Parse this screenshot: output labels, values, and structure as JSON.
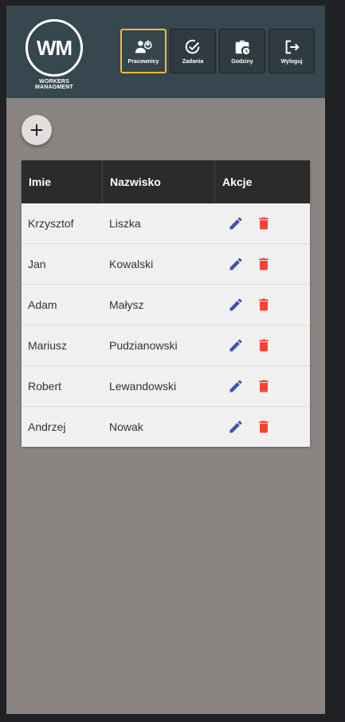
{
  "app": {
    "logo_initials": "WM",
    "logo_caption": "WORKERS MANAGMENT"
  },
  "nav": {
    "items": [
      {
        "label": "Pracownicy",
        "icon": "workers-settings-icon",
        "active": true
      },
      {
        "label": "Zadania",
        "icon": "check-circle-icon",
        "active": false
      },
      {
        "label": "Godziny",
        "icon": "briefcase-clock-icon",
        "active": false
      },
      {
        "label": "Wyloguj",
        "icon": "logout-icon",
        "active": false
      }
    ]
  },
  "add_button": {
    "icon": "plus-icon"
  },
  "table": {
    "headers": [
      "Imie",
      "Nazwisko",
      "Akcje"
    ],
    "rows": [
      {
        "first": "Krzysztof",
        "last": "Liszka"
      },
      {
        "first": "Jan",
        "last": "Kowalski"
      },
      {
        "first": "Adam",
        "last": "Małysz"
      },
      {
        "first": "Mariusz",
        "last": "Pudzianowski"
      },
      {
        "first": "Robert",
        "last": "Lewandowski"
      },
      {
        "first": "Andrzej",
        "last": "Nowak"
      }
    ]
  },
  "colors": {
    "header_bg": "#37474f",
    "active_border": "#f0b93a",
    "edit": "#3f51b5",
    "delete": "#f44336"
  }
}
